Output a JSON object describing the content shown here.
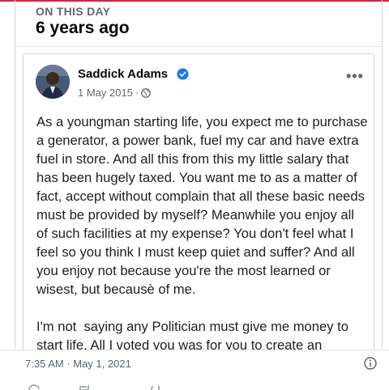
{
  "on_this_day": {
    "label": "ON THIS DAY",
    "heading": "6 years ago"
  },
  "post": {
    "author": "Saddick Adams",
    "date": "1 May 2015",
    "separator": "·",
    "more_label": "•••",
    "paragraphs": [
      "As a youngman starting life, you expect me to purchase a generator, a power bank, fuel my car and have extra fuel in store. And all this from this my little salary that has been hugely taxed. You want me to as a matter of fact, accept without complain that all these basic needs must be provided by myself? Meanwhile you enjoy all of such facilities at my expense? You don't feel what I feel so you think I must keep quiet and suffer? And all you enjoy not because you're the most learned or wisest, but becausè of me.",
      "I'm not  saying any Politician must give me money to start life. All I voted you was for you to create an enabling environment for me to also make life. And so"
    ]
  },
  "tweet_footer": {
    "timestamp": "7:35 AM · May 1, 2021"
  },
  "icons": {
    "verified": "verified-badge-icon",
    "globe": "globe-icon",
    "info": "info-icon",
    "more": "more-options-icon"
  },
  "colors": {
    "accent_red": "#d5243b",
    "verified_blue": "#1877f2",
    "meta_grey": "#65676b"
  }
}
